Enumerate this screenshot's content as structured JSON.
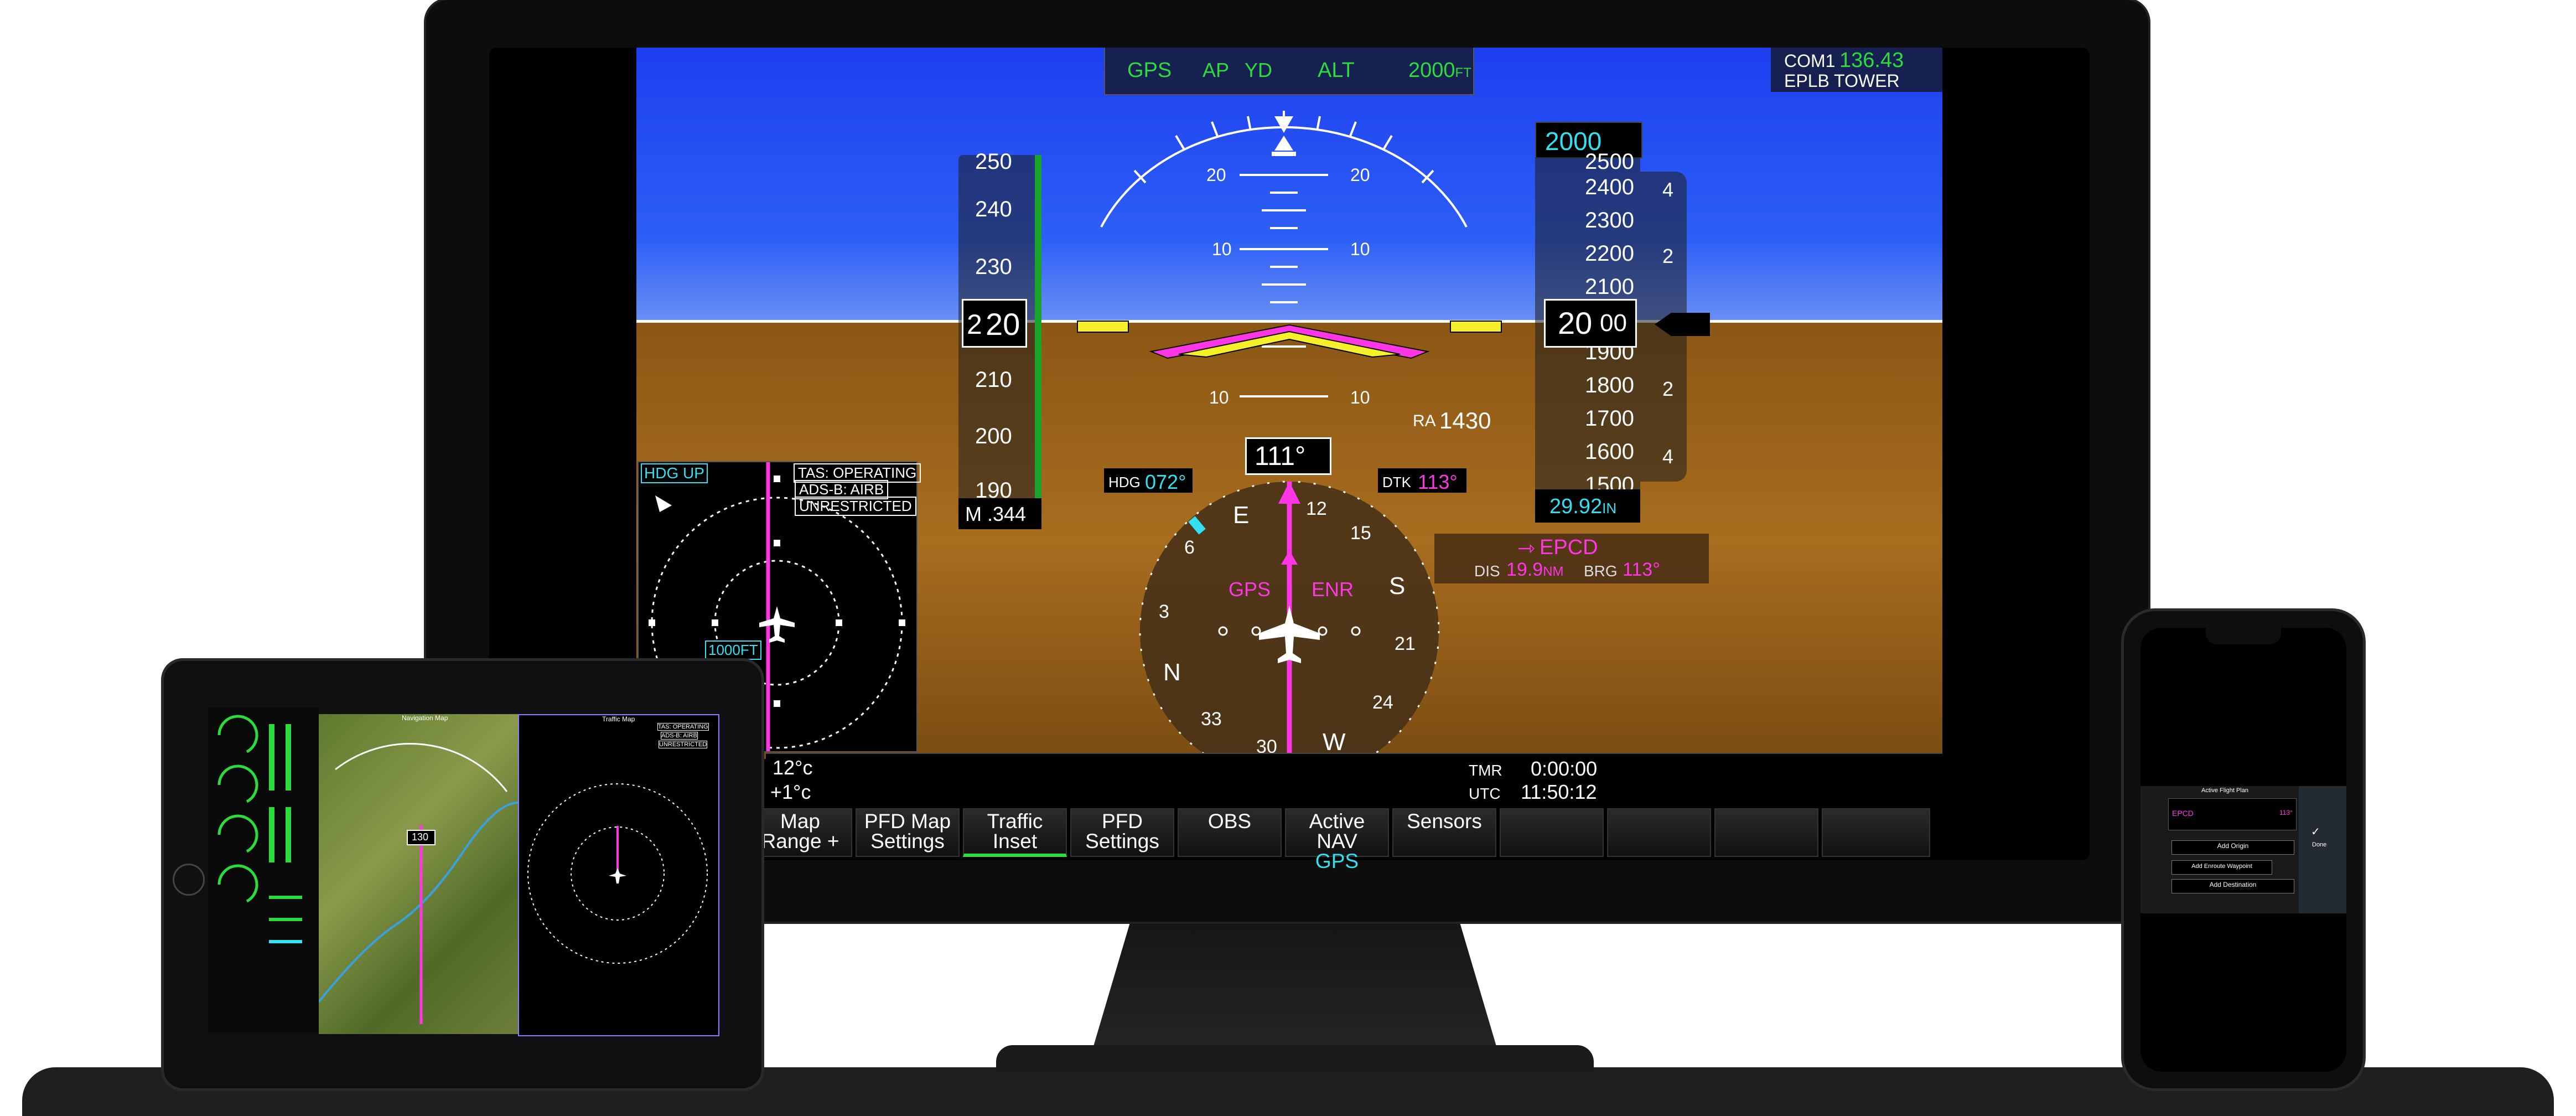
{
  "colors": {
    "sky": "#2d5ff5",
    "ground": "#a86d1f",
    "green": "#2bdc3a",
    "cyan": "#33e0f0",
    "magenta": "#ff36e4",
    "white": "#ffffff"
  },
  "annunciator": {
    "lateral": "GPS",
    "ap": "AP",
    "yd": "YD",
    "vertical": "ALT",
    "target": "2000",
    "target_unit": "FT"
  },
  "com": {
    "label": "COM1",
    "freq": "136.43",
    "station": "EPLB TOWER"
  },
  "airspeed": {
    "ticks": [
      "250",
      "240",
      "230",
      "210",
      "200",
      "190"
    ],
    "current_prefix": "2",
    "current_digits": "20",
    "mach": "M .344"
  },
  "pitch_labels": {
    "up20": "20",
    "up10": "10",
    "down10": "10"
  },
  "altitude": {
    "selected": "2000",
    "selected_suffix": "0",
    "ticks": [
      "2500",
      "2400",
      "2300",
      "2200",
      "2100",
      "1900",
      "1800",
      "1700",
      "1600",
      "1500"
    ],
    "current_main": "20",
    "current_sub": "00",
    "baro": "29.92",
    "baro_unit": "IN",
    "vs_marks": [
      "4",
      "2",
      "2",
      "4"
    ]
  },
  "radar_alt": {
    "label": "RA",
    "value": "1430"
  },
  "hsi": {
    "heading": "111°",
    "hdg_label": "HDG",
    "hdg_bug": "072°",
    "dtk_label": "DTK",
    "dtk": "113°",
    "source": "GPS",
    "mode": "ENR",
    "cardinals": [
      "E",
      "6",
      "12",
      "15",
      "S",
      "21",
      "24",
      "W",
      "30",
      "33",
      "N",
      "3"
    ]
  },
  "waypoint": {
    "id": "EPCD",
    "dis_label": "DIS",
    "dis": "19.9",
    "dis_unit": "NM",
    "brg_label": "BRG",
    "brg": "113°"
  },
  "traffic_inset": {
    "orientation": "HDG UP",
    "status1": "TAS: OPERATING",
    "status2": "ADS-B: AIRB",
    "status3": "UNRESTRICTED",
    "range": "1000FT"
  },
  "temps": {
    "oat": "12°c",
    "isa": "+1°c"
  },
  "timers": {
    "tmr_label": "TMR",
    "tmr": "0:00:00",
    "utc_label": "UTC",
    "utc": "11:50:12"
  },
  "softkeys": [
    {
      "line1": "Map",
      "line2": "Range +"
    },
    {
      "line1": "PFD Map",
      "line2": "Settings"
    },
    {
      "line1": "Traffic",
      "line2": "Inset"
    },
    {
      "line1": "PFD",
      "line2": "Settings"
    },
    {
      "line1": "OBS",
      "line2": ""
    },
    {
      "line1": "Active NAV",
      "line2": "GPS"
    },
    {
      "line1": "Sensors",
      "line2": ""
    },
    {
      "line1": "",
      "line2": ""
    },
    {
      "line1": "",
      "line2": ""
    },
    {
      "line1": "",
      "line2": ""
    },
    {
      "line1": "",
      "line2": ""
    }
  ],
  "tablet": {
    "map_title": "Navigation Map",
    "traffic_title": "Traffic Map",
    "tas": "TAS: OPERATING",
    "adsb": "ADS-B: AIRB",
    "unres": "UNRESTRICTED",
    "hdg": "130"
  },
  "phone": {
    "title": "Active Flight Plan",
    "add_origin": "Add Origin",
    "add_enroute": "Add Enroute Waypoint",
    "add_dest": "Add Destination",
    "wpt": "EPCD",
    "brg": "113°",
    "done": "Done"
  }
}
